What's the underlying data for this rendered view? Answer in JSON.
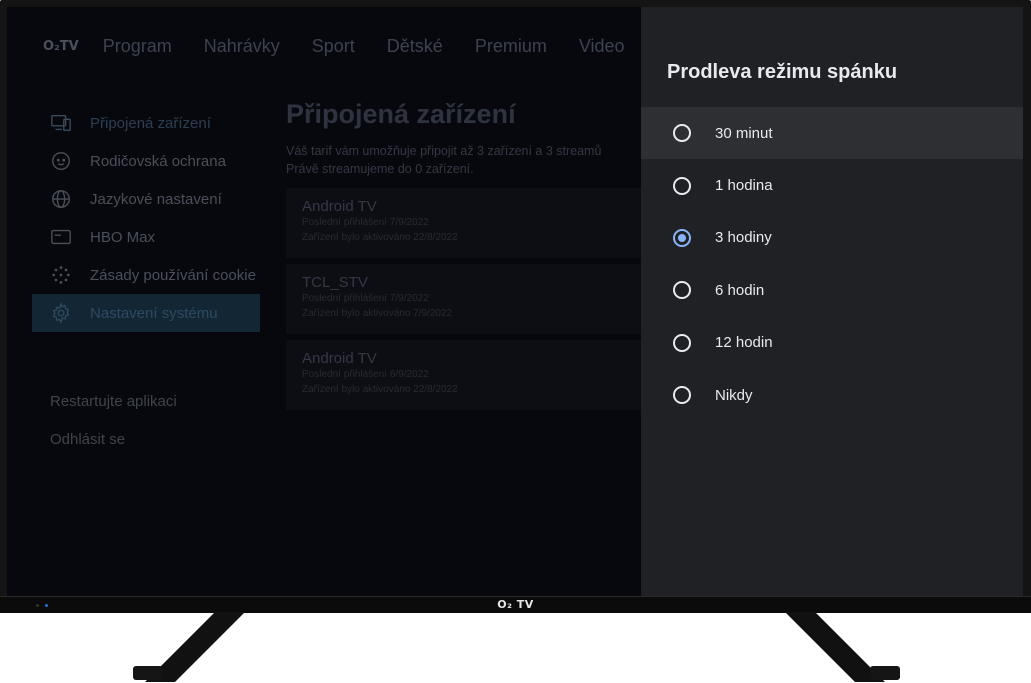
{
  "app": {
    "logo": "O₂TV"
  },
  "top_nav": {
    "items": [
      "Program",
      "Nahrávky",
      "Sport",
      "Dětské",
      "Premium",
      "Video"
    ]
  },
  "sidebar": {
    "items": [
      {
        "label": "Připojená zařízení",
        "icon": "devices-icon",
        "active": false
      },
      {
        "label": "Rodičovská ochrana",
        "icon": "child-face-icon",
        "active": false
      },
      {
        "label": "Jazykové nastavení",
        "icon": "globe-icon",
        "active": false
      },
      {
        "label": "HBO Max",
        "icon": "card-icon",
        "active": false
      },
      {
        "label": "Zásady používání cookie",
        "icon": "cookie-icon",
        "active": false
      },
      {
        "label": "Nastavení systému",
        "icon": "gear-icon",
        "active": true
      }
    ],
    "actions": [
      "Restartujte aplikaci",
      "Odhlásit se"
    ]
  },
  "content": {
    "title": "Připojená zařízení",
    "desc_line1": "Váš tarif vám umožňuje připojit až 3 zařízení a 3 streamů",
    "desc_line2": "Právě streamujeme do 0 zařízení.",
    "devices": [
      {
        "name": "Android TV",
        "last_login": "Poslední přihlášení 7/9/2022",
        "activated": "Zařízení bylo aktivováno 22/8/2022"
      },
      {
        "name": "TCL_STV",
        "last_login": "Poslední přihlášení 7/9/2022",
        "activated": "Zařízení bylo aktivováno 7/9/2022"
      },
      {
        "name": "Android TV",
        "last_login": "Poslední přihlášení 6/9/2022",
        "activated": "Zařízení bylo aktivováno 22/8/2022"
      }
    ]
  },
  "panel": {
    "title": "Prodleva režimu spánku",
    "options": [
      {
        "label": "30 minut",
        "checked": false,
        "focused": true
      },
      {
        "label": "1 hodina",
        "checked": false,
        "focused": false
      },
      {
        "label": "3 hodiny",
        "checked": true,
        "focused": false
      },
      {
        "label": "6 hodin",
        "checked": false,
        "focused": false
      },
      {
        "label": "12 hodin",
        "checked": false,
        "focused": false
      },
      {
        "label": "Nikdy",
        "checked": false,
        "focused": false
      }
    ]
  },
  "bezel": {
    "brand": "O₂ TV"
  },
  "colors": {
    "accent": "#8ab4f8",
    "panel_bg": "#202124",
    "focus_bg": "#2e2f33"
  }
}
